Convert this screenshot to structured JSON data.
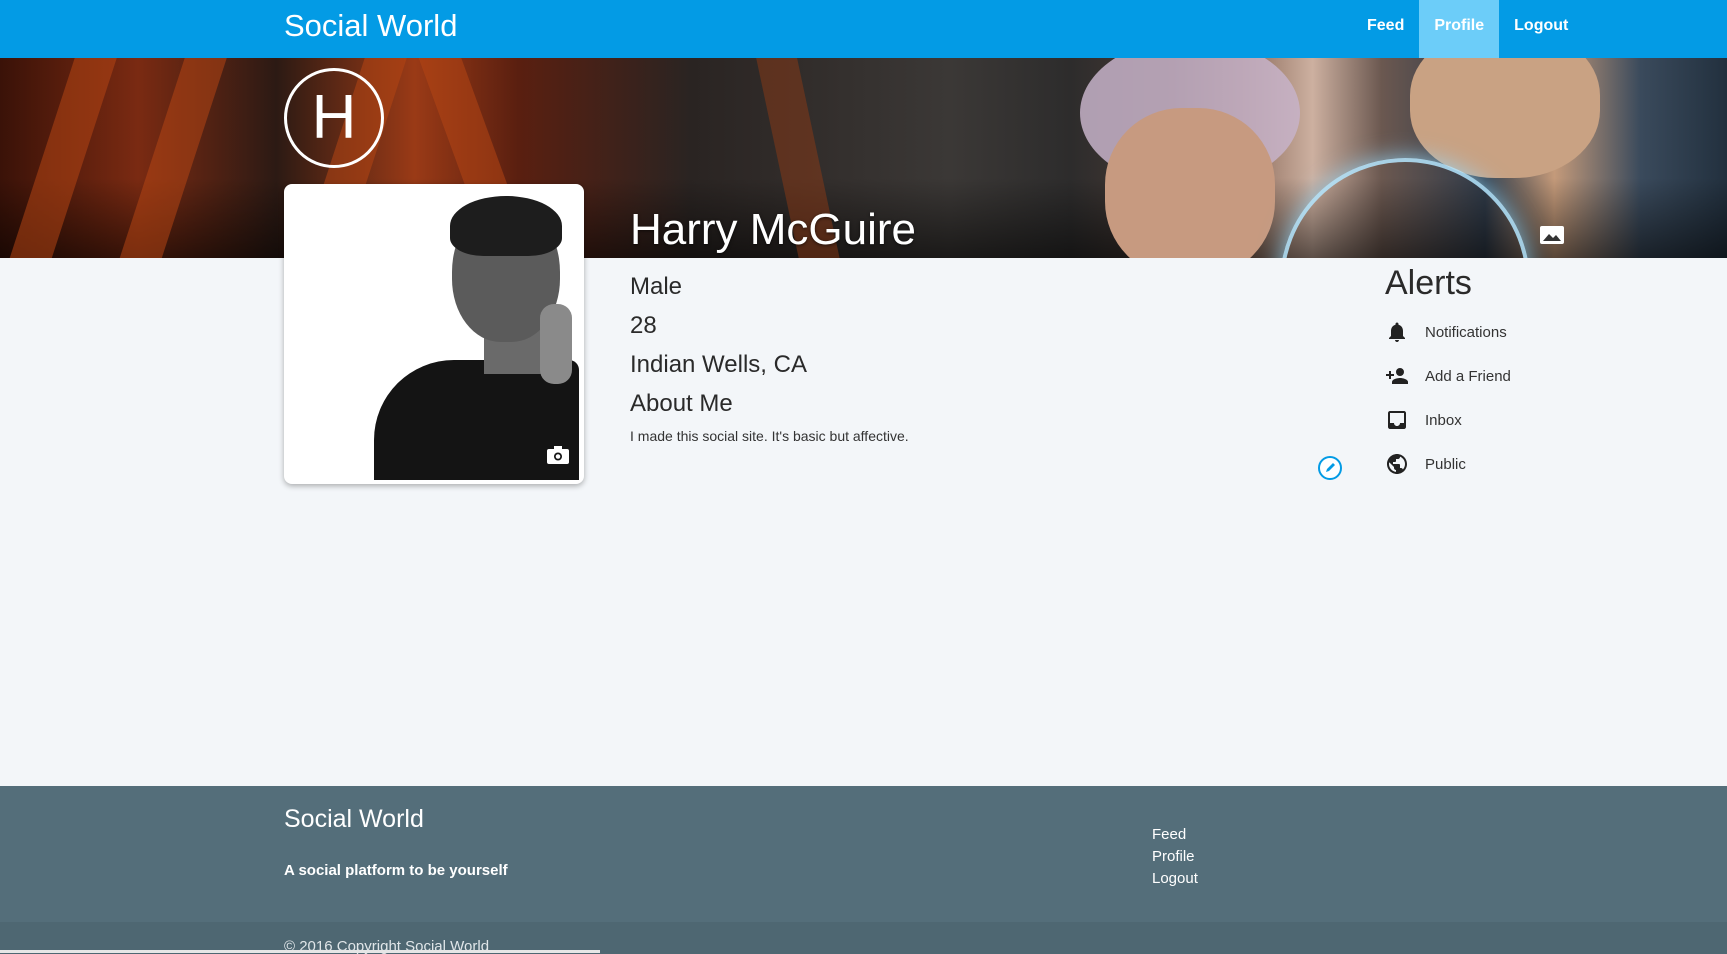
{
  "navbar": {
    "brand": "Social World",
    "links": [
      {
        "label": "Feed",
        "active": false
      },
      {
        "label": "Profile",
        "active": true
      },
      {
        "label": "Logout",
        "active": false
      }
    ]
  },
  "banner": {
    "initial": "H",
    "photo_icon": "image-icon"
  },
  "profile": {
    "name": "Harry McGuire",
    "gender": "Male",
    "age": "28",
    "location": "Indian Wells, CA",
    "about_heading": "About Me",
    "about_text": "I made this social site. It's basic but affective.",
    "camera_icon": "camera-icon",
    "edit_icon": "pencil-icon"
  },
  "alerts": {
    "title": "Alerts",
    "items": [
      {
        "label": "Notifications",
        "icon": "bell-icon"
      },
      {
        "label": "Add a Friend",
        "icon": "add-person-icon"
      },
      {
        "label": "Inbox",
        "icon": "inbox-icon"
      },
      {
        "label": "Public",
        "icon": "globe-icon"
      }
    ]
  },
  "footer": {
    "brand": "Social World",
    "tagline": "A social platform to be yourself",
    "links": [
      "Feed",
      "Profile",
      "Logout"
    ],
    "copyright": "© 2016 Copyright Social World"
  },
  "colors": {
    "primary": "#039be5",
    "active_tab": "#6ccdf9",
    "footer": "#546e7a",
    "background": "#f3f6f9"
  }
}
